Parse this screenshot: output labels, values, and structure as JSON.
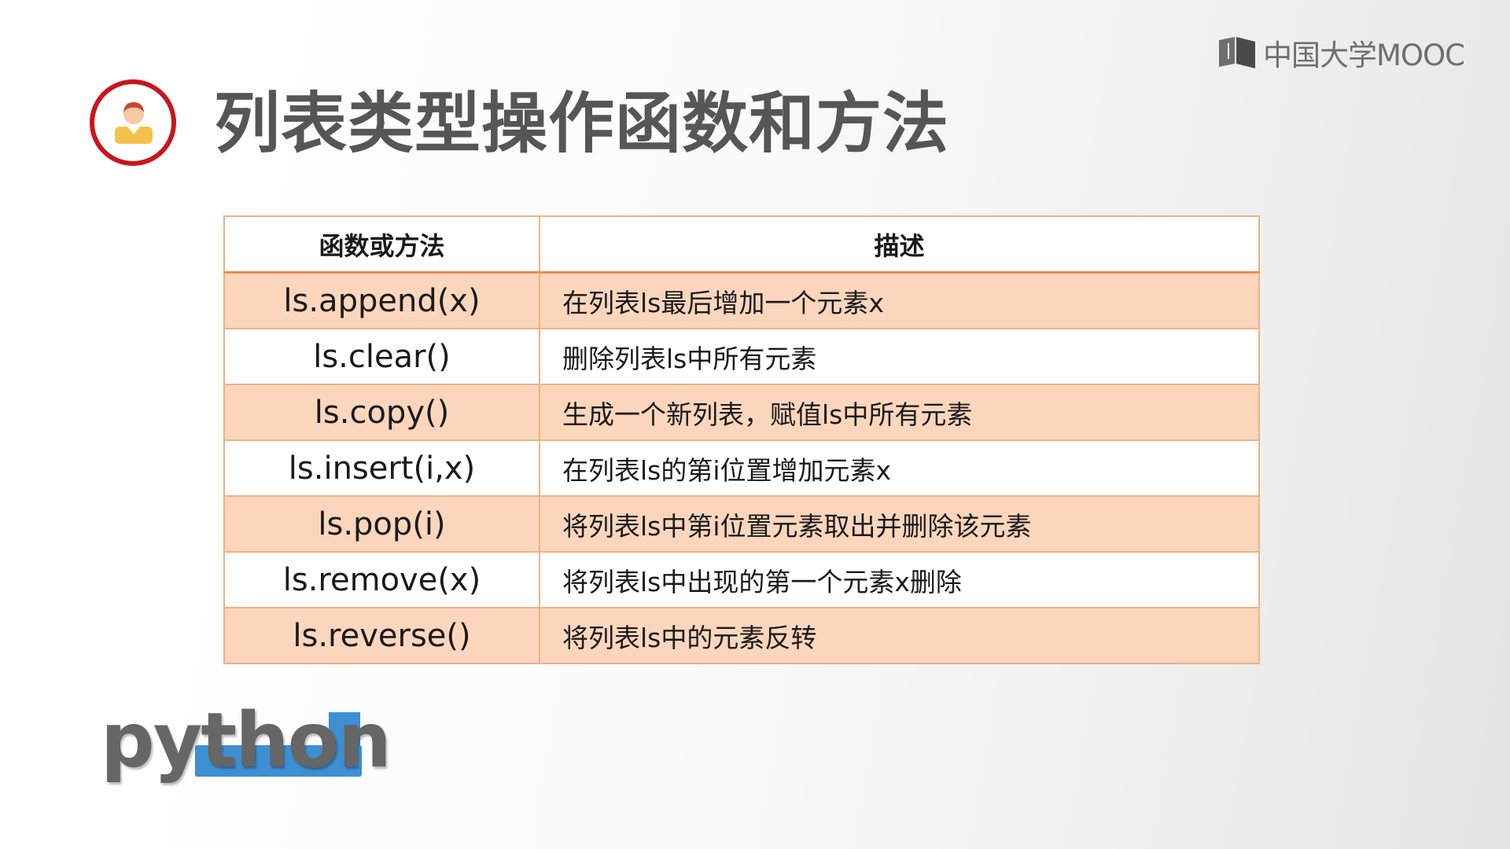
{
  "brand": {
    "mooc_logo_text": "中国大学MOOC",
    "python_logo_text": "python"
  },
  "slide": {
    "title": "列表类型操作函数和方法"
  },
  "table": {
    "headers": [
      "函数或方法",
      "描述"
    ],
    "rows": [
      {
        "fn": "ls.append(x)",
        "desc": "在列表ls最后增加一个元素x"
      },
      {
        "fn": "ls.clear()",
        "desc": "删除列表ls中所有元素"
      },
      {
        "fn": "ls.copy()",
        "desc": "生成一个新列表，赋值ls中所有元素"
      },
      {
        "fn": "ls.insert(i,x)",
        "desc": "在列表ls的第i位置增加元素x"
      },
      {
        "fn": "ls.pop(i)",
        "desc": "将列表ls中第i位置元素取出并删除该元素"
      },
      {
        "fn": "ls.remove(x)",
        "desc": "将列表ls中出现的第一个元素x删除"
      },
      {
        "fn": "ls.reverse()",
        "desc": "将列表ls中的元素反转"
      }
    ]
  },
  "icons": {
    "title_icon": "person-icon",
    "mooc_icon": "book-icon"
  },
  "colors": {
    "accent_red": "#c9161c",
    "table_row_fill": "#fbd6bd",
    "table_border": "#f1b185",
    "python_blue": "#3e8ed2"
  }
}
